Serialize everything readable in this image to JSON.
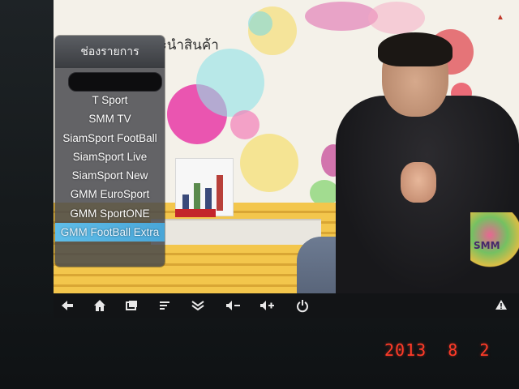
{
  "broadcast": {
    "title_fragment": "แนะนำสินค้า",
    "station_logo": "SMM"
  },
  "channel_panel": {
    "header": "ช่องรายการ",
    "search_placeholder": "",
    "channels": [
      {
        "label": "T Sport",
        "active": false
      },
      {
        "label": "SMM TV",
        "active": false
      },
      {
        "label": "SiamSport FootBall",
        "active": false
      },
      {
        "label": "SiamSport Live",
        "active": false
      },
      {
        "label": "SiamSport New",
        "active": false
      },
      {
        "label": "GMM EuroSport",
        "active": false
      },
      {
        "label": "GMM SportONE",
        "active": false
      },
      {
        "label": "GMM FootBall Extra",
        "active": true
      }
    ]
  },
  "navbar": {
    "back_icon": "back-icon",
    "home_icon": "home-icon",
    "recent_apps_icon": "recent-apps-icon",
    "menu_icon": "menu-icon",
    "collapse_icon": "chevron-down-double-icon",
    "volume_down_icon": "volume-down-icon",
    "volume_up_icon": "volume-up-icon",
    "power_icon": "power-icon",
    "warning_icon": "warning-icon"
  },
  "camera_date": "2013  8  2",
  "colors": {
    "active_item": "#5fbde8",
    "date_stamp": "#ff3b28"
  }
}
